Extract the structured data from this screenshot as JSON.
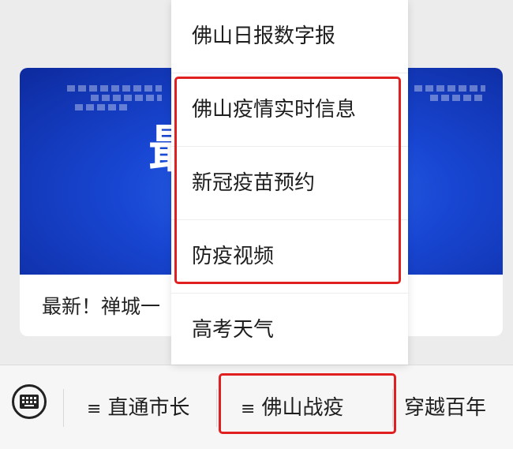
{
  "card": {
    "banner_glyph": "最",
    "title": "最新！禅城一"
  },
  "menu": {
    "items": [
      {
        "label": "佛山日报数字报"
      },
      {
        "label": "佛山疫情实时信息"
      },
      {
        "label": "新冠疫苗预约"
      },
      {
        "label": "防疫视频"
      },
      {
        "label": "高考天气"
      }
    ]
  },
  "bottom_bar": {
    "keyboard_icon": "keyboard-icon",
    "menu_icon_glyph": "≡",
    "tabs": [
      {
        "label": "直通市长"
      },
      {
        "label": "佛山战疫"
      },
      {
        "label": "穿越百年"
      }
    ]
  },
  "annotations": {
    "highlight_color": "#e02020"
  }
}
